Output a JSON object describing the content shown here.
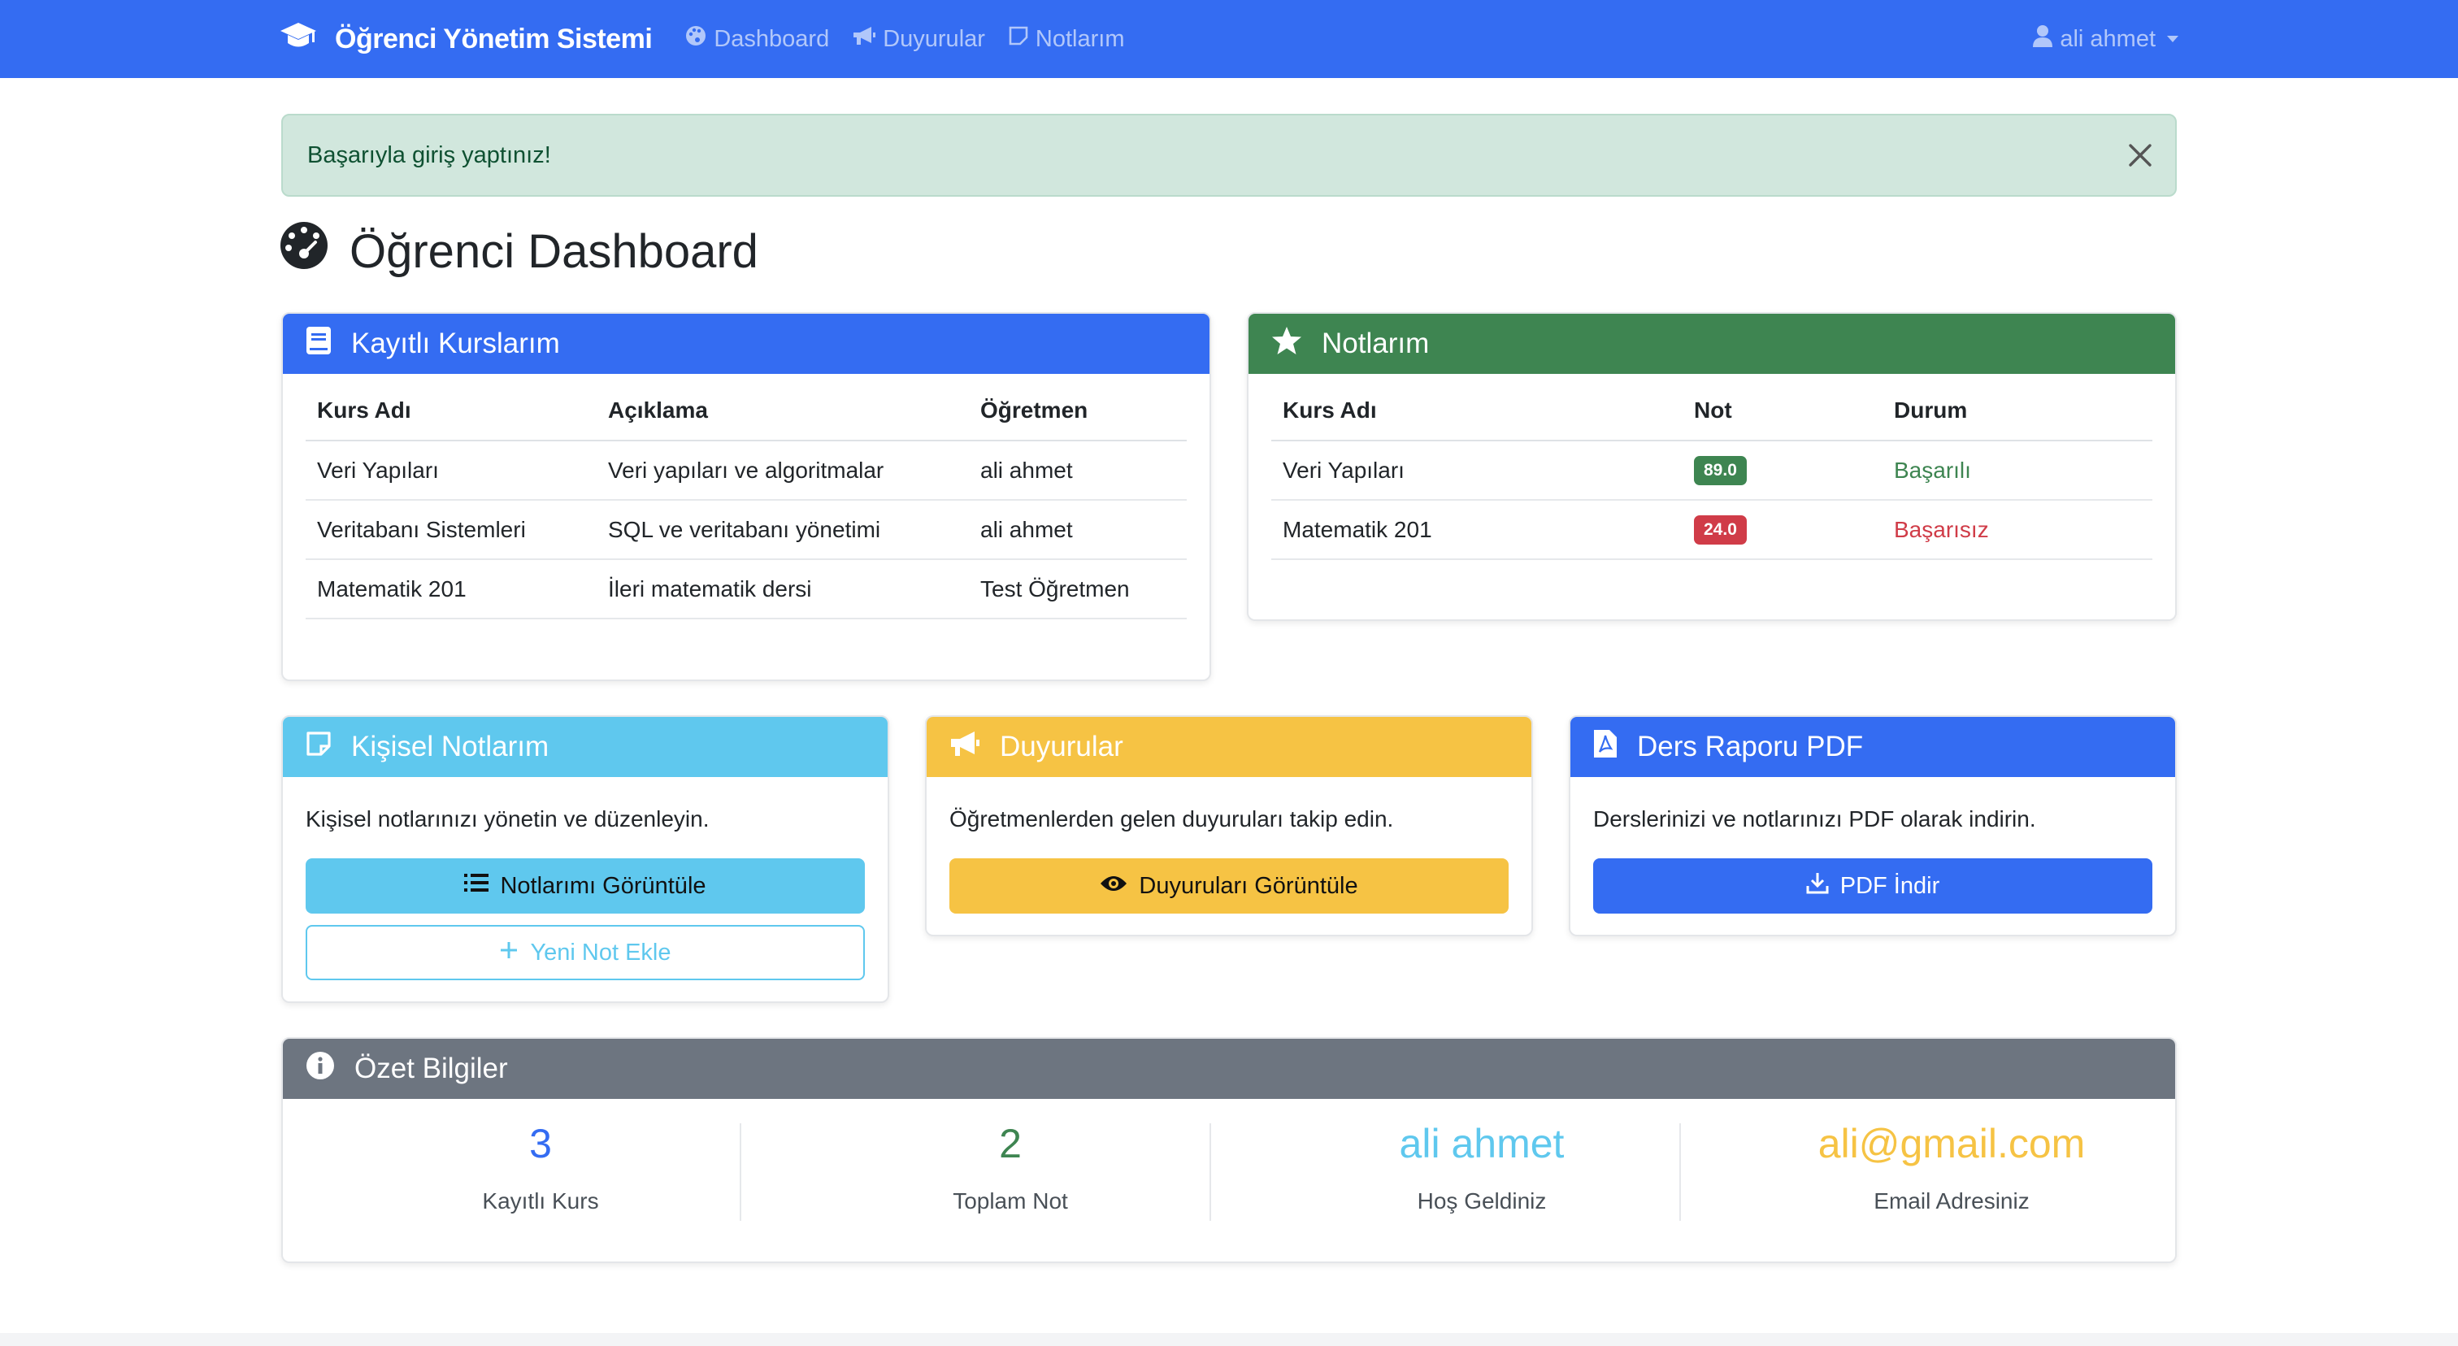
{
  "navbar": {
    "brand": "Öğrenci Yönetim Sistemi",
    "links": [
      {
        "label": "Dashboard",
        "icon": "palette-icon"
      },
      {
        "label": "Duyurular",
        "icon": "megaphone-icon"
      },
      {
        "label": "Notlarım",
        "icon": "sticky-note-icon"
      }
    ],
    "user": "ali ahmet"
  },
  "alert": {
    "message": "Başarıyla giriş yaptınız!"
  },
  "page": {
    "title": "Öğrenci Dashboard"
  },
  "courses": {
    "title": "Kayıtlı Kurslarım",
    "columns": [
      "Kurs Adı",
      "Açıklama",
      "Öğretmen"
    ],
    "rows": [
      [
        "Veri Yapıları",
        "Veri yapıları ve algoritmalar",
        "ali ahmet"
      ],
      [
        "Veritabanı Sistemleri",
        "SQL ve veritabanı yönetimi",
        "ali ahmet"
      ],
      [
        "Matematik 201",
        "İleri matematik dersi",
        "Test Öğretmen"
      ]
    ]
  },
  "grades": {
    "title": "Notlarım",
    "columns": [
      "Kurs Adı",
      "Not",
      "Durum"
    ],
    "rows": [
      {
        "course": "Veri Yapıları",
        "grade": "89.0",
        "status": "Başarılı"
      },
      {
        "course": "Matematik 201",
        "grade": "24.0",
        "status": "Başarısız"
      }
    ]
  },
  "personal_notes": {
    "title": "Kişisel Notlarım",
    "text": "Kişisel notlarınızı yönetin ve düzenleyin.",
    "view_button": "Notlarımı Görüntüle",
    "add_button": "Yeni Not Ekle"
  },
  "announcements": {
    "title": "Duyurular",
    "text": "Öğretmenlerden gelen duyuruları takip edin.",
    "view_button": "Duyuruları Görüntüle"
  },
  "report": {
    "title": "Ders Raporu PDF",
    "text": "Derslerinizi ve notlarınızı PDF olarak indirin.",
    "download_button": "PDF İndir"
  },
  "summary": {
    "title": "Özet Bilgiler",
    "stats": [
      {
        "value": "3",
        "label": "Kayıtlı Kurs"
      },
      {
        "value": "2",
        "label": "Toplam Not"
      },
      {
        "value": "ali ahmet",
        "label": "Hoş Geldiniz"
      },
      {
        "value": "ali@gmail.com",
        "label": "Email Adresiniz"
      }
    ]
  },
  "colors": {
    "primary": "#346cf2",
    "success": "#3e8551",
    "info": "#5fc8ee",
    "warning": "#f6c344",
    "secondary": "#6d7580",
    "danger": "#d03c48"
  }
}
